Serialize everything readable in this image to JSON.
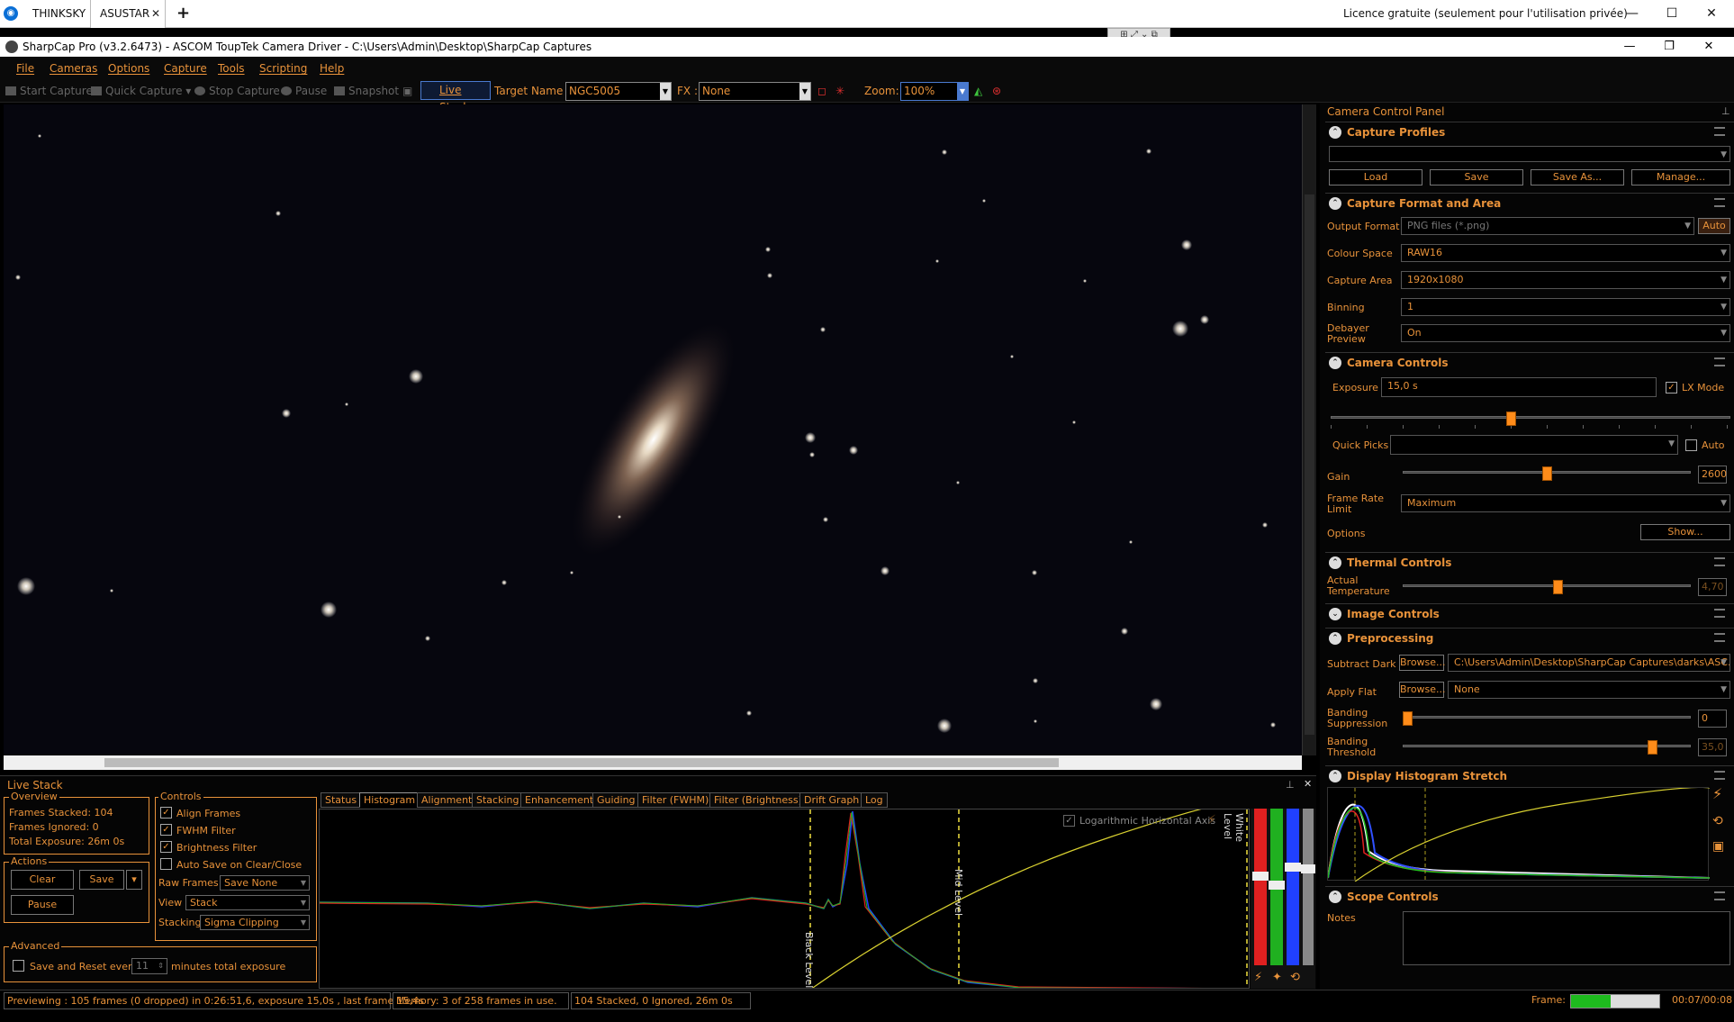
{
  "remote_desktop": {
    "tabs": [
      {
        "label": "THINKSKY"
      },
      {
        "label": "ASUSTAR",
        "active": true
      }
    ],
    "licence_text": "Licence gratuite (seulement pour l'utilisation privée)"
  },
  "app": {
    "title": "SharpCap Pro (v3.2.6473) - ASCOM ToupTek Camera Driver - C:\\Users\\Admin\\Desktop\\SharpCap Captures"
  },
  "menu": [
    "File",
    "Cameras",
    "Options",
    "Capture",
    "Tools",
    "Scripting",
    "Help"
  ],
  "toolbar": {
    "start_capture": "Start Capture",
    "quick_capture": "Quick Capture",
    "stop_capture": "Stop Capture",
    "pause": "Pause",
    "snapshot": "Snapshot",
    "live_stack": "Live Stack",
    "target_label": "Target Name :",
    "target_value": "NGC5005",
    "fx_label": "FX :",
    "fx_value": "None",
    "zoom_label": "Zoom:",
    "zoom_value": "100%"
  },
  "ccp": {
    "title": "Camera Control Panel",
    "capture_profiles": {
      "header": "Capture Profiles",
      "load": "Load",
      "save": "Save",
      "save_as": "Save As...",
      "manage": "Manage..."
    },
    "format": {
      "header": "Capture Format and Area",
      "output_format_label": "Output Format",
      "output_format": "PNG files (*.png)",
      "auto": "Auto",
      "colour_space_label": "Colour Space",
      "colour_space": "RAW16",
      "capture_area_label": "Capture Area",
      "capture_area": "1920x1080",
      "binning_label": "Binning",
      "binning": "1",
      "debayer_label": "Debayer Preview",
      "debayer": "On"
    },
    "camera": {
      "header": "Camera Controls",
      "exposure_label": "Exposure",
      "exposure": "15,0 s",
      "lx_mode": "LX Mode",
      "quick_picks_label": "Quick Picks",
      "quick_auto": "Auto",
      "gain_label": "Gain",
      "gain": "2600",
      "gain_fraction": 0.5,
      "exposure_fraction": 0.45,
      "frame_rate_label": "Frame Rate Limit",
      "frame_rate": "Maximum",
      "options_label": "Options",
      "show": "Show..."
    },
    "thermal": {
      "header": "Thermal Controls",
      "temp_label": "Actual Temperature",
      "temp": "4,70",
      "temp_fraction": 0.54
    },
    "image": {
      "header": "Image Controls"
    },
    "preprocessing": {
      "header": "Preprocessing",
      "subtract_dark_label": "Subtract Dark",
      "browse": "Browse...",
      "dark_path": "C:\\Users\\Admin\\Desktop\\SharpCap Captures\\darks\\ASC...",
      "apply_flat_label": "Apply Flat",
      "flat": "None",
      "banding_supp_label": "Banding Suppression",
      "banding_supp": "0",
      "banding_supp_fraction": 0.0,
      "banding_thr_label": "Banding Threshold",
      "banding_thr": "35,0",
      "banding_thr_fraction": 0.88
    },
    "display_stretch": {
      "header": "Display Histogram Stretch"
    },
    "scope": {
      "header": "Scope Controls",
      "notes_label": "Notes"
    }
  },
  "live_stack": {
    "title": "Live Stack",
    "overview": {
      "header": "Overview",
      "frames_stacked": "Frames Stacked: 104",
      "frames_ignored": "Frames Ignored:  0",
      "total_exposure": "Total Exposure:  26m 0s"
    },
    "actions": {
      "header": "Actions",
      "clear": "Clear",
      "save": "Save",
      "pause": "Pause"
    },
    "advanced": {
      "header": "Advanced",
      "save_reset_label": "Save and Reset every",
      "minutes_value": "11",
      "minutes_label": "minutes total exposure"
    },
    "controls": {
      "header": "Controls",
      "align_frames": "Align Frames",
      "fwhm_filter": "FWHM Filter",
      "brightness_filter": "Brightness Filter",
      "auto_save": "Auto Save on Clear/Close",
      "raw_frames_label": "Raw Frames",
      "raw_frames": "Save None",
      "view_label": "View",
      "view": "Stack",
      "stacking_label": "Stacking",
      "stacking": "Sigma Clipping"
    },
    "tabs": [
      "Status",
      "Histogram",
      "Alignment",
      "Stacking",
      "Enhancement",
      "Guiding",
      "Filter (FWHM)",
      "Filter (Brightness)",
      "Drift Graph",
      "Log"
    ],
    "active_tab": "Histogram",
    "histogram": {
      "log_axis_label": "Logarithmic Horizontal Axis",
      "black_level": "Black Level",
      "mid_level": "Mid Level",
      "white_level": "White Level"
    }
  },
  "status_bar": {
    "previewing": "Previewing : 105 frames (0 dropped) in 0:26:51,6, exposure 15,0s , last frame 15,4s",
    "memory": "Memory: 3 of 258 frames in use.",
    "stacked": "104 Stacked, 0 Ignored, 26m 0s",
    "frame_label": "Frame:",
    "frame_progress": 0.45,
    "frame_time": "00:07/00:08"
  },
  "colors": {
    "accent": "#e8923a",
    "background": "#050505",
    "slider": "#ff8c1a",
    "progress": "#1eba1e"
  }
}
